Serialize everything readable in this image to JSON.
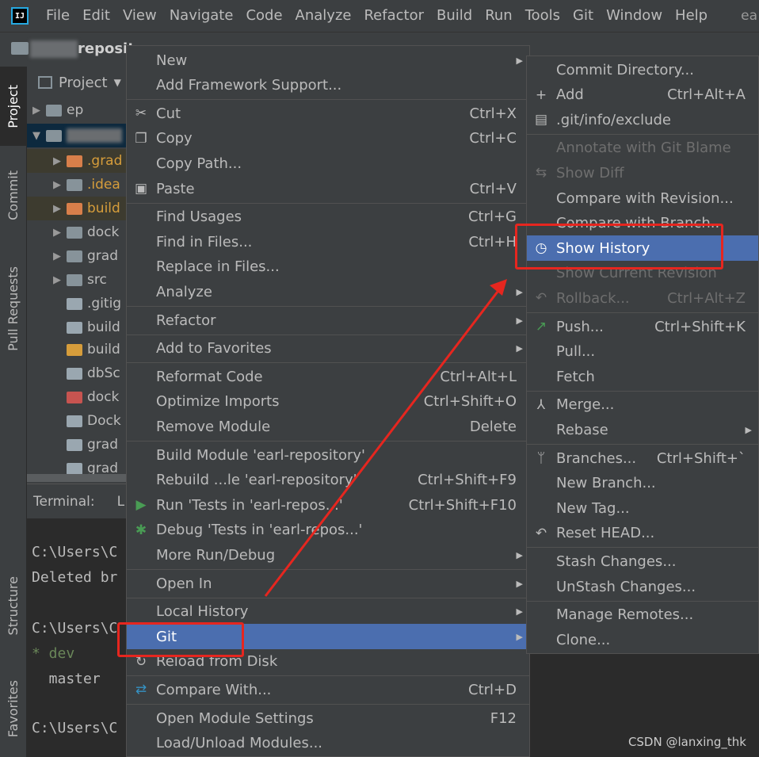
{
  "menubar": {
    "items": [
      "File",
      "Edit",
      "View",
      "Navigate",
      "Code",
      "Analyze",
      "Refactor",
      "Build",
      "Run",
      "Tools",
      "Git",
      "Window",
      "Help"
    ],
    "trailing": "ea"
  },
  "navbar": {
    "project_fragment": "reposito"
  },
  "left_tabs": [
    "Project",
    "Commit",
    "Pull Requests",
    "Structure",
    "Favorites"
  ],
  "project_panel": {
    "title": "Project",
    "rows": [
      {
        "label": "ep",
        "color": "#87939a"
      },
      {
        "label": "",
        "color": "#87939a"
      },
      {
        "label": ".grad",
        "color": "#d87f4a",
        "text_color": "#d69d3b"
      },
      {
        "label": ".idea",
        "color": "#87939a",
        "text_color": "#d69d3b"
      },
      {
        "label": "build",
        "color": "#d87f4a",
        "text_color": "#d69d3b"
      },
      {
        "label": "dock",
        "color": "#87939a"
      },
      {
        "label": "grad",
        "color": "#87939a"
      },
      {
        "label": "src",
        "color": "#87939a"
      },
      {
        "label": ".gitig",
        "color": "#9aa7b0"
      },
      {
        "label": "build",
        "color": "#9aa7b0"
      },
      {
        "label": "build",
        "color": "#d69d3b"
      },
      {
        "label": "dbSc",
        "color": "#9aa7b0"
      },
      {
        "label": "dock",
        "color": "#c75450"
      },
      {
        "label": "Dock",
        "color": "#9aa7b0"
      },
      {
        "label": "grad",
        "color": "#9aa7b0"
      },
      {
        "label": "grad",
        "color": "#9aa7b0"
      }
    ]
  },
  "terminal": {
    "tab_label": "Terminal:",
    "tab_local": "L",
    "lines": [
      "C:\\Users\\C",
      "Deleted br",
      "",
      "C:\\Users\\C",
      "* dev",
      "  master",
      "",
      "C:\\Users\\C"
    ]
  },
  "context_menu": {
    "items": [
      {
        "label": "New",
        "submenu": true
      },
      {
        "label": "Add Framework Support..."
      },
      {
        "sep": true
      },
      {
        "label": "Cut",
        "shortcut": "Ctrl+X",
        "icon": "scissors-icon",
        "glyph": "✂"
      },
      {
        "label": "Copy",
        "shortcut": "Ctrl+C",
        "icon": "copy-icon",
        "glyph": "❐"
      },
      {
        "label": "Copy Path..."
      },
      {
        "label": "Paste",
        "shortcut": "Ctrl+V",
        "icon": "paste-icon",
        "glyph": "▣"
      },
      {
        "sep": true
      },
      {
        "label": "Find Usages",
        "shortcut": "Ctrl+G"
      },
      {
        "label": "Find in Files...",
        "shortcut": "Ctrl+H"
      },
      {
        "label": "Replace in Files..."
      },
      {
        "label": "Analyze",
        "submenu": true
      },
      {
        "sep": true
      },
      {
        "label": "Refactor",
        "submenu": true
      },
      {
        "sep": true
      },
      {
        "label": "Add to Favorites",
        "submenu": true
      },
      {
        "sep": true
      },
      {
        "label": "Reformat Code",
        "shortcut": "Ctrl+Alt+L"
      },
      {
        "label": "Optimize Imports",
        "shortcut": "Ctrl+Shift+O"
      },
      {
        "label": "Remove Module",
        "shortcut": "Delete"
      },
      {
        "sep": true
      },
      {
        "label": "Build Module 'earl-repository'"
      },
      {
        "label": "Rebuild ...le 'earl-repository'",
        "shortcut": "Ctrl+Shift+F9"
      },
      {
        "label": "Run 'Tests in 'earl-repos...'",
        "shortcut": "Ctrl+Shift+F10",
        "icon": "run-icon",
        "glyph": "▶",
        "glyph_color": "#499c54"
      },
      {
        "label": "Debug 'Tests in 'earl-repos...'",
        "icon": "debug-icon",
        "glyph": "✱",
        "glyph_color": "#499c54"
      },
      {
        "label": "More Run/Debug",
        "submenu": true
      },
      {
        "sep": true
      },
      {
        "label": "Open In",
        "submenu": true
      },
      {
        "sep": true
      },
      {
        "label": "Local History",
        "submenu": true
      },
      {
        "label": "Git",
        "submenu": true,
        "selected": true
      },
      {
        "label": "Reload from Disk",
        "icon": "reload-icon",
        "glyph": "↻"
      },
      {
        "sep": true
      },
      {
        "label": "Compare With...",
        "shortcut": "Ctrl+D",
        "icon": "compare-icon",
        "glyph": "⇄",
        "glyph_color": "#3592c4"
      },
      {
        "sep": true
      },
      {
        "label": "Open Module Settings",
        "shortcut": "F12"
      },
      {
        "label": "Load/Unload Modules..."
      }
    ]
  },
  "git_submenu": {
    "items": [
      {
        "label": "Commit Directory..."
      },
      {
        "label": "Add",
        "shortcut": "Ctrl+Alt+A",
        "icon": "plus-icon",
        "glyph": "+"
      },
      {
        "label": ".git/info/exclude",
        "icon": "git-file-icon",
        "glyph": "▤"
      },
      {
        "sep": true
      },
      {
        "label": "Annotate with Git Blame",
        "disabled": true
      },
      {
        "label": "Show Diff",
        "disabled": true,
        "icon": "diff-icon",
        "glyph": "⇆"
      },
      {
        "label": "Compare with Revision..."
      },
      {
        "label": "Compare with Branch..."
      },
      {
        "label": "Show History",
        "selected": true,
        "icon": "clock-icon",
        "glyph": "◷"
      },
      {
        "label": "Show Current Revision",
        "disabled": true
      },
      {
        "label": "Rollback...",
        "shortcut": "Ctrl+Alt+Z",
        "disabled": true,
        "icon": "rollback-icon",
        "glyph": "↶"
      },
      {
        "sep": true
      },
      {
        "label": "Push...",
        "shortcut": "Ctrl+Shift+K",
        "icon": "push-arrow-icon",
        "glyph": "↗",
        "glyph_color": "#499c54"
      },
      {
        "label": "Pull..."
      },
      {
        "label": "Fetch"
      },
      {
        "sep": true
      },
      {
        "label": "Merge...",
        "icon": "merge-icon",
        "glyph": "⅄"
      },
      {
        "label": "Rebase",
        "submenu": true
      },
      {
        "sep": true
      },
      {
        "label": "Branches...",
        "shortcut": "Ctrl+Shift+`",
        "icon": "branch-icon",
        "glyph": "ᛘ"
      },
      {
        "label": "New Branch..."
      },
      {
        "label": "New Tag..."
      },
      {
        "label": "Reset HEAD...",
        "icon": "reset-icon",
        "glyph": "↶"
      },
      {
        "sep": true
      },
      {
        "label": "Stash Changes..."
      },
      {
        "label": "UnStash Changes..."
      },
      {
        "sep": true
      },
      {
        "label": "Manage Remotes..."
      },
      {
        "label": "Clone..."
      }
    ]
  },
  "watermark": "CSDN @lanxing_thk",
  "colors": {
    "selection": "#4b6eaf",
    "annotation": "#e6261f",
    "panel": "#3c3f41",
    "editor": "#2b2b2b"
  }
}
